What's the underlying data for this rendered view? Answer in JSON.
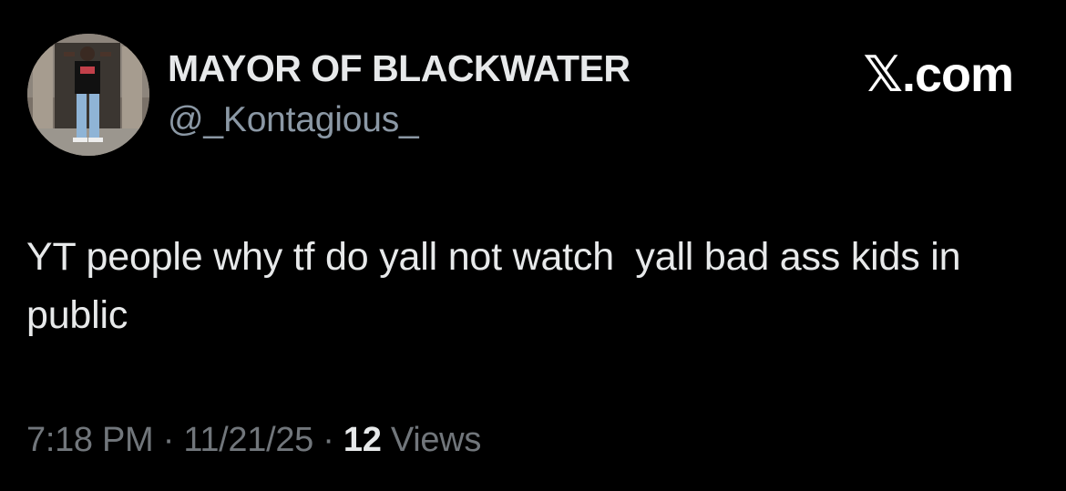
{
  "author": {
    "display_name": "MAYOR OF BLACKWATER",
    "handle": "@_Kontagious_"
  },
  "watermark": "𝕏.com",
  "tweet": {
    "text": "YT people why tf do yall not watch  yall bad ass kids in public"
  },
  "meta": {
    "time": "7:18 PM",
    "separator": "·",
    "date": "11/21/25",
    "views_count": "12",
    "views_label": "Views"
  },
  "colors": {
    "background": "#000000",
    "primary_text": "#e7e9ea",
    "secondary_text": "#71767b"
  }
}
